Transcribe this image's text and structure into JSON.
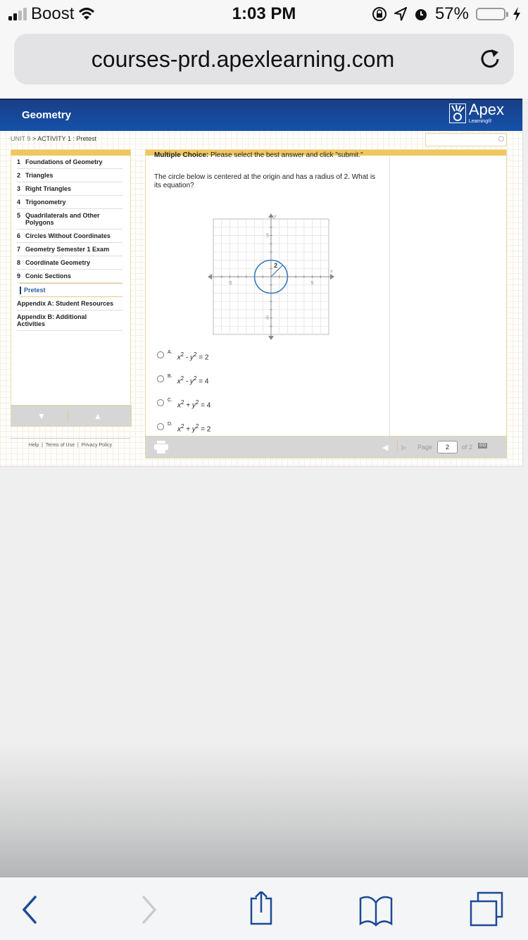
{
  "status_bar": {
    "carrier": "Boost",
    "time": "1:03 PM",
    "battery": "57%",
    "battery_level": 0.57,
    "icons": [
      "signal-icon",
      "wifi-icon",
      "rotation-lock-icon",
      "location-icon",
      "alarm-icon",
      "battery-icon",
      "charging-icon"
    ]
  },
  "browser": {
    "url": "courses-prd.apexlearning.com",
    "reload_icon": "reload-icon",
    "toolbar": [
      "back-icon",
      "forward-icon",
      "share-icon",
      "bookmarks-icon",
      "tabs-icon"
    ]
  },
  "header": {
    "course_title": "Geometry",
    "logo_word": "Apex",
    "logo_sub": "Learning®"
  },
  "breadcrumb": {
    "unit": "UNIT 9",
    "separator": " > ",
    "rest": "ACTIVITY 1 : Pretest"
  },
  "search": {
    "placeholder": "",
    "label": "Search"
  },
  "sidebar": {
    "items": [
      {
        "num": "1",
        "label": "Foundations of Geometry"
      },
      {
        "num": "2",
        "label": "Triangles"
      },
      {
        "num": "3",
        "label": "Right Triangles"
      },
      {
        "num": "4",
        "label": "Trigonometry"
      },
      {
        "num": "5",
        "label": "Quadrilaterals and Other Polygons"
      },
      {
        "num": "6",
        "label": "Circles Without Coordinates"
      },
      {
        "num": "7",
        "label": "Geometry Semester 1 Exam"
      },
      {
        "num": "8",
        "label": "Coordinate Geometry"
      },
      {
        "num": "9",
        "label": "Conic Sections"
      }
    ],
    "active_item": "Pretest",
    "appendices": [
      "Appendix A: Student Resources",
      "Appendix B: Additional Activities"
    ]
  },
  "footer": {
    "links": [
      "Help",
      "Terms of Use",
      "Privacy Policy"
    ],
    "separator": "|"
  },
  "question": {
    "instruction_bold": "Multiple Choice:",
    "instruction_rest": " Please select the best answer and click \"submit.\"",
    "prompt": "The circle below is centered at the origin and has a radius of 2. What is its equation?",
    "graph": {
      "x_axis_label": "x",
      "y_axis_label": "y",
      "tick_labels": {
        "x_neg": "-5",
        "x_pos": "5",
        "y_pos": "5",
        "y_neg": "-5"
      },
      "range": [
        -7,
        7
      ],
      "circle_center": [
        0,
        0
      ],
      "circle_radius": 2,
      "radius_label": "2",
      "circle_color": "#3a7bbf"
    },
    "choices": [
      {
        "letter": "A.",
        "lhs_a": "x",
        "op": " - ",
        "lhs_b": "y",
        "rhs": " = 2"
      },
      {
        "letter": "B.",
        "lhs_a": "x",
        "op": " - ",
        "lhs_b": "y",
        "rhs": " = 4"
      },
      {
        "letter": "C.",
        "lhs_a": "x",
        "op": " + ",
        "lhs_b": "y",
        "rhs": " = 4"
      },
      {
        "letter": "D.",
        "lhs_a": "x",
        "op": " + ",
        "lhs_b": "y",
        "rhs": " = 2"
      }
    ],
    "exponent": "2"
  },
  "pager": {
    "page_label": "Page",
    "current_page": "2",
    "of_label": "of 2",
    "go_label": "GO"
  },
  "colors": {
    "header_blue": "#164a9c",
    "accent_yellow": "#f0c75e",
    "link_blue": "#2b5d9c",
    "ios_blue": "#1c4a96"
  }
}
